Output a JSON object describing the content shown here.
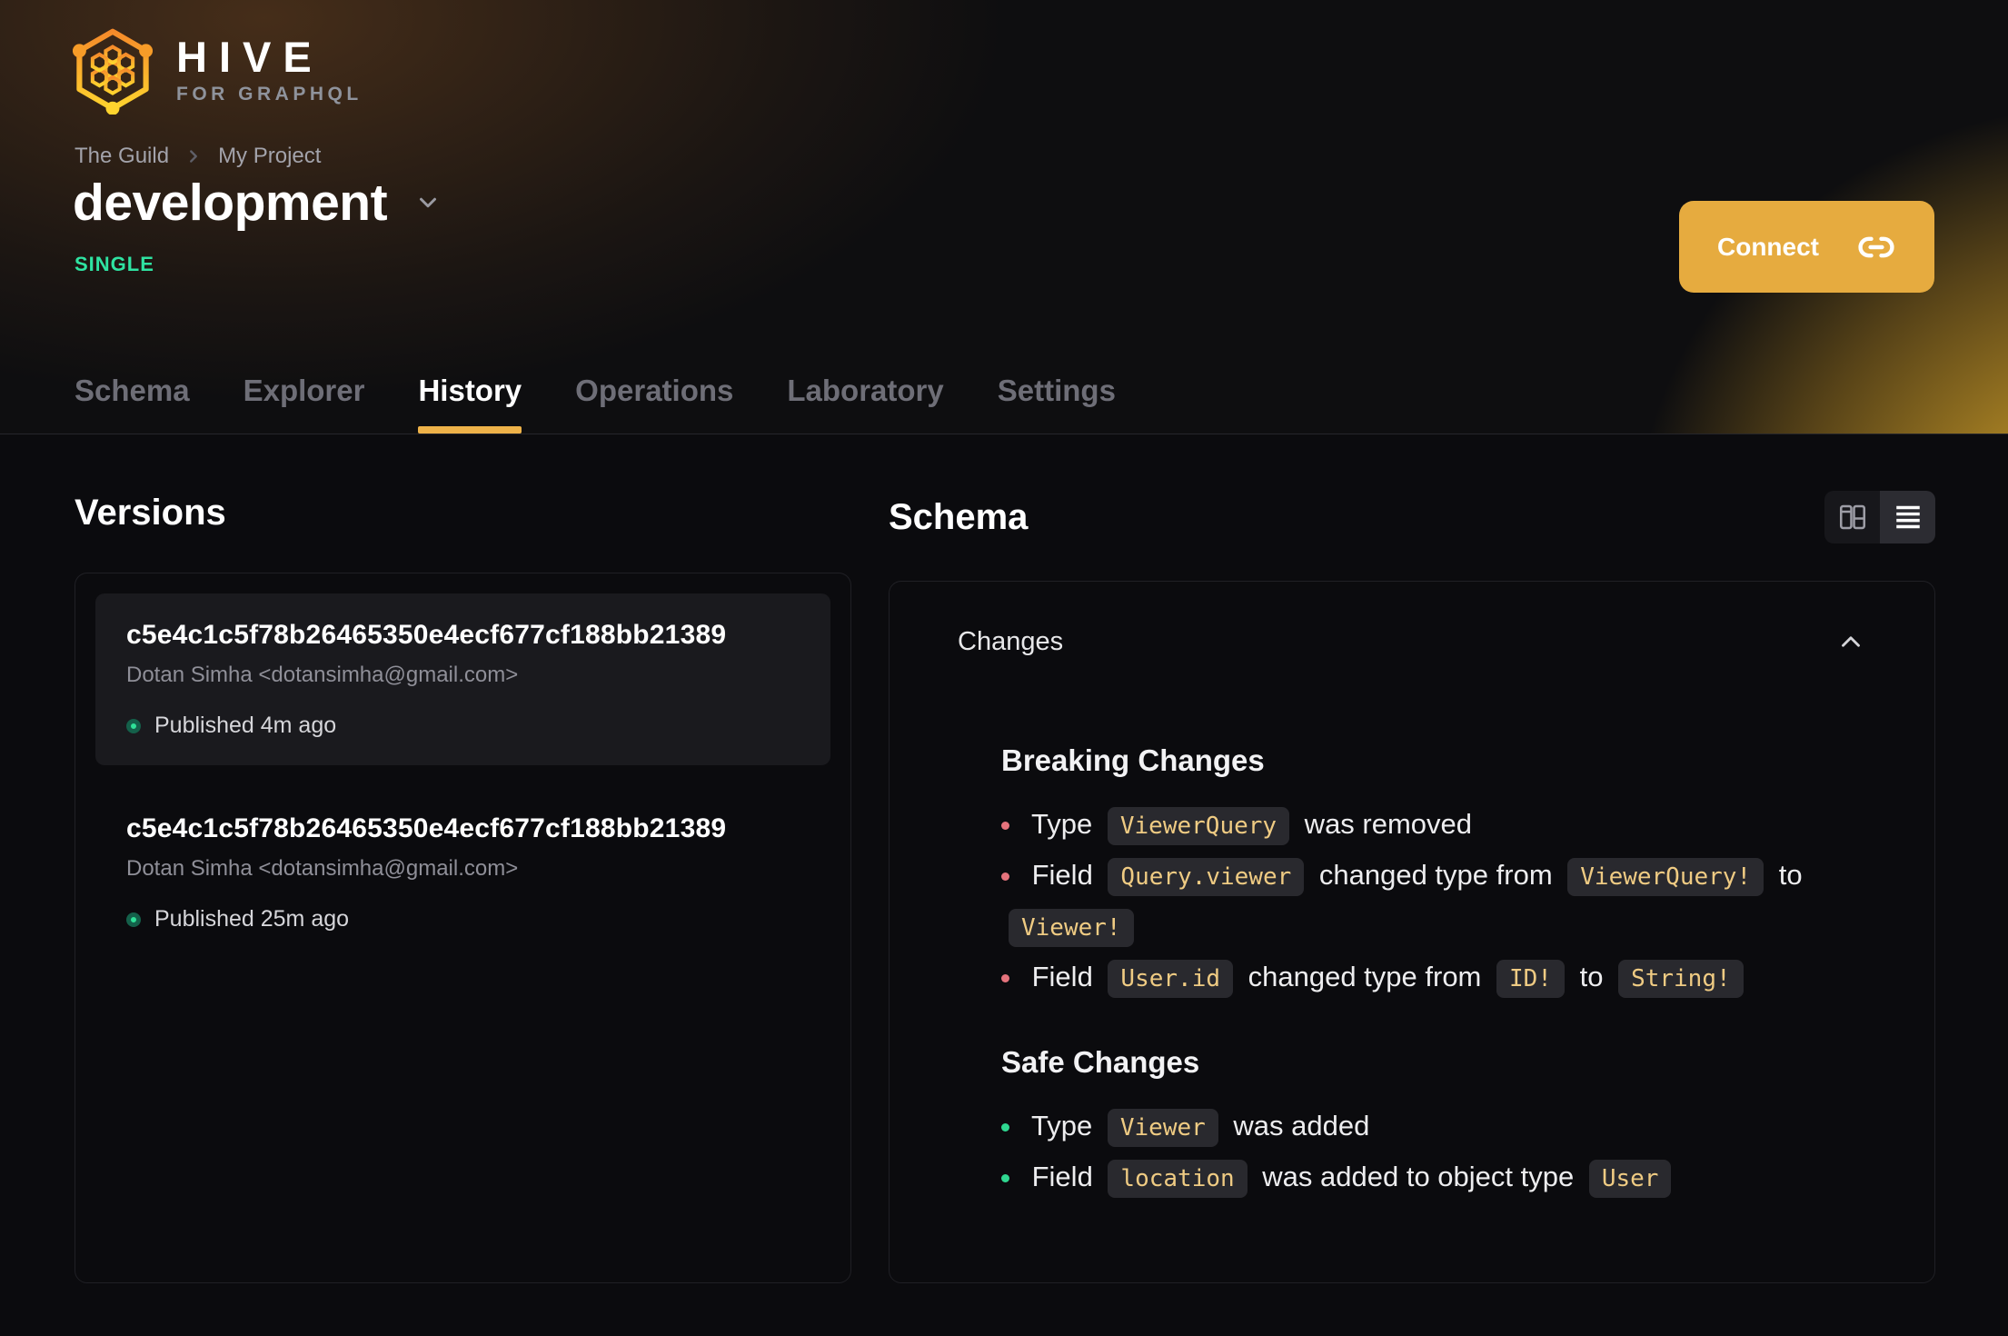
{
  "brand": {
    "name": "HIVE",
    "tagline": "FOR GRAPHQL"
  },
  "breadcrumb": {
    "items": [
      "The Guild",
      "My Project"
    ]
  },
  "target": {
    "name": "development",
    "badge": "SINGLE"
  },
  "connect": {
    "label": "Connect"
  },
  "tabs": [
    {
      "label": "Schema",
      "active": false
    },
    {
      "label": "Explorer",
      "active": false
    },
    {
      "label": "History",
      "active": true
    },
    {
      "label": "Operations",
      "active": false
    },
    {
      "label": "Laboratory",
      "active": false
    },
    {
      "label": "Settings",
      "active": false
    }
  ],
  "versions": {
    "title": "Versions",
    "items": [
      {
        "hash": "c5e4c1c5f78b26465350e4ecf677cf188bb21389",
        "author": "Dotan Simha <dotansimha@gmail.com>",
        "status": "Published 4m ago",
        "selected": true
      },
      {
        "hash": "c5e4c1c5f78b26465350e4ecf677cf188bb21389",
        "author": "Dotan Simha <dotansimha@gmail.com>",
        "status": "Published 25m ago",
        "selected": false
      }
    ]
  },
  "schema_panel": {
    "title": "Schema",
    "changes_title": "Changes",
    "view_toggle": [
      {
        "name": "columns-view",
        "active": false
      },
      {
        "name": "list-view",
        "active": true
      }
    ],
    "sections": [
      {
        "title": "Breaking Changes",
        "bullet_color": "#e5737c",
        "items": [
          [
            {
              "t": "text",
              "v": "Type"
            },
            {
              "t": "code",
              "v": "ViewerQuery"
            },
            {
              "t": "text",
              "v": "was removed"
            }
          ],
          [
            {
              "t": "text",
              "v": "Field"
            },
            {
              "t": "code",
              "v": "Query.viewer"
            },
            {
              "t": "text",
              "v": "changed type from"
            },
            {
              "t": "code",
              "v": "ViewerQuery!"
            },
            {
              "t": "text",
              "v": "to"
            },
            {
              "t": "code",
              "v": "Viewer!"
            }
          ],
          [
            {
              "t": "text",
              "v": "Field"
            },
            {
              "t": "code",
              "v": "User.id"
            },
            {
              "t": "text",
              "v": "changed type from"
            },
            {
              "t": "code",
              "v": "ID!"
            },
            {
              "t": "text",
              "v": "to"
            },
            {
              "t": "code",
              "v": "String!"
            }
          ]
        ]
      },
      {
        "title": "Safe Changes",
        "bullet_color": "#2fd790",
        "items": [
          [
            {
              "t": "text",
              "v": "Type"
            },
            {
              "t": "code",
              "v": "Viewer"
            },
            {
              "t": "text",
              "v": "was added"
            }
          ],
          [
            {
              "t": "text",
              "v": "Field"
            },
            {
              "t": "code",
              "v": "location"
            },
            {
              "t": "text",
              "v": "was added to object type"
            },
            {
              "t": "code",
              "v": "User"
            }
          ]
        ]
      }
    ]
  },
  "colors": {
    "accent": "#e6ab3f",
    "tab_underline": "#eeb249",
    "badge_green": "#2fe3a2",
    "published_dot": "#2fe098",
    "chip_text": "#efcb83",
    "breaking_bullet": "#e5737c",
    "safe_bullet": "#2fd790"
  }
}
